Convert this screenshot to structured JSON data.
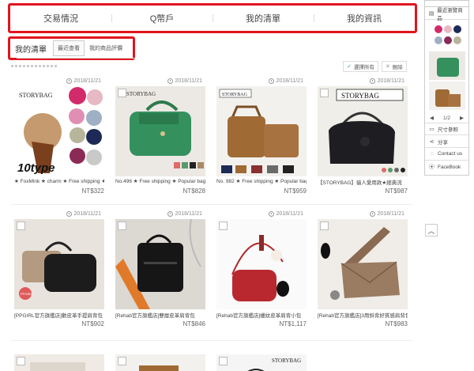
{
  "top_tabs": [
    "交易情況",
    "Q幣戶",
    "我的清單",
    "我的資訊"
  ],
  "sub_nav": {
    "title": "我的清單",
    "tabs": [
      "最近查看",
      "我的商品評價"
    ]
  },
  "actions": {
    "select_all": "選擇所有",
    "delete": "刪除"
  },
  "products": [
    {
      "date": "2018/11/21",
      "name": "★ FoxMink ★ charm ★ Free shipping ★ FoxMink",
      "price": "NT$322"
    },
    {
      "date": "2018/11/21",
      "name": "No.496 ★ Free shipping ★ Popular bag",
      "price": "NT$828"
    },
    {
      "date": "2018/11/21",
      "name": "No. 982 ★ Free shipping ★ Popular bag",
      "price": "NT$959"
    },
    {
      "date": "2018/11/21",
      "name": "【STORYBAG】貓人愛用款★經典流",
      "price": "NT$987"
    },
    {
      "date": "2018/11/21",
      "name": "[PPGIRL官方旗艦店]歡皮革手提肩背包",
      "price": "NT$902"
    },
    {
      "date": "2018/11/21",
      "name": "[Rehab官方旗艦店]雙層皮革肩背包",
      "price": "NT$846"
    },
    {
      "date": "2018/11/21",
      "name": "[Rehab官方旗艦店]蠟紋皮革肩背小包",
      "price": "NT$1,117"
    },
    {
      "date": "2018/11/21",
      "name": "[Rehab官方旗艦店]3用斜背好質感肩背包",
      "price": "NT$983"
    },
    {
      "date": "",
      "name": "",
      "price": ""
    },
    {
      "date": "",
      "name": "",
      "price": ""
    },
    {
      "date": "",
      "name": "",
      "price": ""
    }
  ],
  "image_labels": {
    "storybag": "STORYBAG",
    "ten_type": "10type",
    "ppgirl": "PPGIRL"
  },
  "right_panel": {
    "title": "最近瀏覽商品",
    "pager": {
      "prev": "◀",
      "page": "1/2",
      "next": "▶"
    },
    "links": [
      "尺寸參照",
      "分享",
      "Contact us",
      "FaceBook"
    ],
    "link_icons": [
      "ruler-icon",
      "share-icon",
      "chat-icon",
      "location-icon"
    ]
  },
  "icons": {
    "back_to_top": "chevron-up-icon",
    "check": "check-icon",
    "delete": "x-icon",
    "clock": "clock-icon"
  },
  "colors": {
    "highlight": "#e0151f",
    "check": "#3aa35d"
  }
}
